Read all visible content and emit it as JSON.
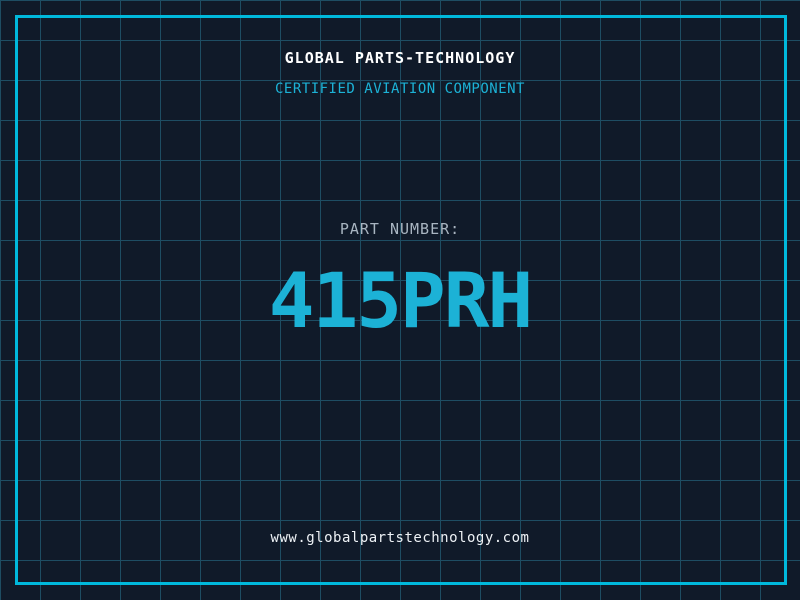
{
  "header": {
    "title": "GLOBAL PARTS-TECHNOLOGY",
    "subtitle": "CERTIFIED AVIATION COMPONENT"
  },
  "part": {
    "label": "PART NUMBER:",
    "number": "415PRH"
  },
  "footer": {
    "website": "www.globalpartstechnology.com"
  },
  "colors": {
    "background": "#101a29",
    "grid_line": "#1e4d63",
    "frame_border": "#00b8dc",
    "accent_cyan": "#1cb2d6",
    "title_white": "#ffffff",
    "label_gray": "#a9b5c1",
    "url_white": "#eef2f6"
  }
}
